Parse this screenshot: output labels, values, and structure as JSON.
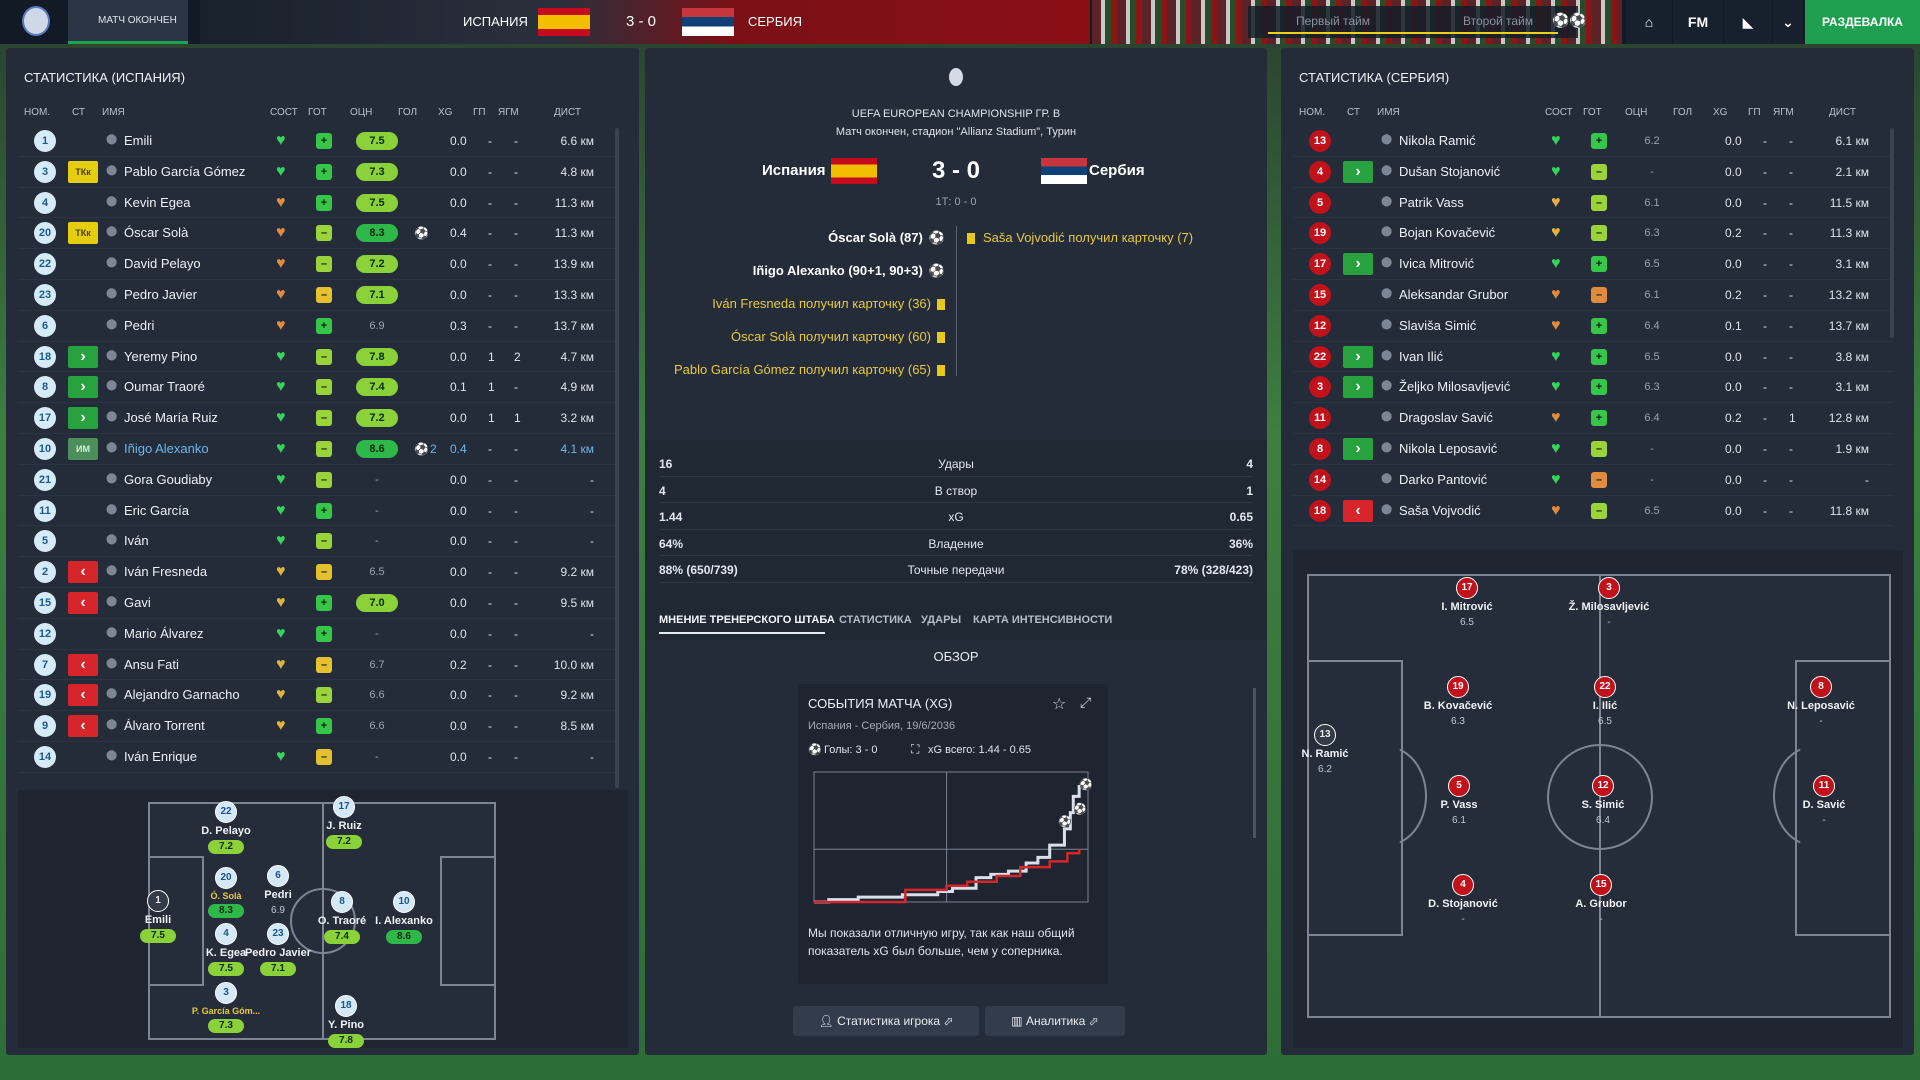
{
  "colors": {
    "accent_green": "#1fa050",
    "rating_green": "#2fb84a",
    "rating_lime": "#8ad13a",
    "rating_yellow": "#d6c23a",
    "heart_green": "#35d45a",
    "heart_orange": "#e08b3e",
    "red": "#c1121b",
    "blue": "#6ab7ee"
  },
  "topbar": {
    "status": "МАТЧ ОКОНЧЕН",
    "home_team": "ИСПАНИЯ",
    "score": "3 - 0",
    "away_team": "СЕРБИЯ",
    "first_half": "Первый тайм",
    "second_half": "Второй тайм",
    "fm_label": "FM",
    "continue_button": "РАЗДЕВАЛКА"
  },
  "left": {
    "title": "СТАТИСТИКА (ИСПАНИЯ)"
  },
  "right": {
    "title": "СТАТИСТИКА (СЕРБИЯ)"
  },
  "columns": {
    "num": "НОМ.",
    "st": "СТ",
    "name": "ИМЯ",
    "cond": "СОСТ",
    "fit": "ГОТ",
    "rating": "ОЦН",
    "goals": "ГОЛ",
    "xg": "XG",
    "gp": "ГП",
    "ygm": "ЯГМ",
    "dist": "ДИСТ"
  },
  "spain_players": [
    {
      "num": "1",
      "st": "",
      "name": "Emili",
      "cond": "green",
      "fit": "green",
      "rating": "7.5",
      "rc": "g",
      "goals": "",
      "xg": "0.0",
      "gp": "-",
      "ygm": "-",
      "dist": "6.6 км"
    },
    {
      "num": "3",
      "st": "cap",
      "st_label": "ТКк",
      "name": "Pablo García Gómez",
      "cond": "green",
      "fit": "green",
      "rating": "7.3",
      "rc": "g",
      "goals": "",
      "xg": "0.0",
      "gp": "-",
      "ygm": "-",
      "dist": "4.8 км"
    },
    {
      "num": "4",
      "st": "",
      "name": "Kevin Egea",
      "cond": "orange",
      "fit": "green",
      "rating": "7.5",
      "rc": "g",
      "goals": "",
      "xg": "0.0",
      "gp": "-",
      "ygm": "-",
      "dist": "11.3 км"
    },
    {
      "num": "20",
      "st": "cap",
      "st_label": "ТКк",
      "name": "Óscar Solà",
      "cond": "orange",
      "fit": "lime",
      "rating": "8.3",
      "rc": "g",
      "goals": "1",
      "xg": "0.4",
      "gp": "-",
      "ygm": "-",
      "dist": "11.3 км"
    },
    {
      "num": "22",
      "st": "",
      "name": "David Pelayo",
      "cond": "orange",
      "fit": "lime",
      "rating": "7.2",
      "rc": "g",
      "goals": "",
      "xg": "0.0",
      "gp": "-",
      "ygm": "-",
      "dist": "13.9 км"
    },
    {
      "num": "23",
      "st": "",
      "name": "Pedro Javier",
      "cond": "orange",
      "fit": "yellow",
      "rating": "7.1",
      "rc": "g",
      "goals": "",
      "xg": "0.0",
      "gp": "-",
      "ygm": "-",
      "dist": "13.3 км"
    },
    {
      "num": "6",
      "st": "",
      "name": "Pedri",
      "cond": "orange",
      "fit": "green",
      "rating": "6.9",
      "rc": "n",
      "goals": "",
      "xg": "0.3",
      "gp": "-",
      "ygm": "-",
      "dist": "13.7 км"
    },
    {
      "num": "18",
      "st": "in",
      "name": "Yeremy Pino",
      "cond": "green",
      "fit": "lime",
      "rating": "7.8",
      "rc": "g",
      "goals": "",
      "xg": "0.0",
      "gp": "1",
      "ygm": "2",
      "dist": "4.7 км"
    },
    {
      "num": "8",
      "st": "in",
      "name": "Oumar Traoré",
      "cond": "green",
      "fit": "lime",
      "rating": "7.4",
      "rc": "g",
      "goals": "",
      "xg": "0.1",
      "gp": "1",
      "ygm": "-",
      "dist": "4.9 км"
    },
    {
      "num": "17",
      "st": "in",
      "name": "José María Ruiz",
      "cond": "green",
      "fit": "lime",
      "rating": "7.2",
      "rc": "g",
      "goals": "",
      "xg": "0.0",
      "gp": "1",
      "ygm": "1",
      "dist": "3.2 км"
    },
    {
      "num": "10",
      "st": "ic",
      "st_label": "ИМ",
      "name": "Iñigo Alexanko",
      "cond": "green",
      "fit": "lime",
      "rating": "8.6",
      "rc": "g",
      "goals": "2",
      "xg": "0.4",
      "gp": "-",
      "ygm": "-",
      "dist": "4.1 км",
      "hl": true
    },
    {
      "num": "21",
      "st": "",
      "name": "Gora Goudiaby",
      "cond": "green",
      "fit": "lime",
      "rating": "-",
      "rc": "n",
      "goals": "",
      "xg": "0.0",
      "gp": "-",
      "ygm": "-",
      "dist": "-"
    },
    {
      "num": "11",
      "st": "",
      "name": "Eric García",
      "cond": "green",
      "fit": "green",
      "rating": "-",
      "rc": "n",
      "goals": "",
      "xg": "0.0",
      "gp": "-",
      "ygm": "-",
      "dist": "-"
    },
    {
      "num": "5",
      "st": "",
      "name": "Iván",
      "cond": "green",
      "fit": "lime",
      "rating": "-",
      "rc": "n",
      "goals": "",
      "xg": "0.0",
      "gp": "-",
      "ygm": "-",
      "dist": "-"
    },
    {
      "num": "2",
      "st": "out",
      "name": "Iván Fresneda",
      "cond": "yellow",
      "fit": "yellow",
      "rating": "6.5",
      "rc": "n",
      "goals": "",
      "xg": "0.0",
      "gp": "-",
      "ygm": "-",
      "dist": "9.2 км"
    },
    {
      "num": "15",
      "st": "out",
      "name": "Gavi",
      "cond": "yellow",
      "fit": "green",
      "rating": "7.0",
      "rc": "g",
      "goals": "",
      "xg": "0.0",
      "gp": "-",
      "ygm": "-",
      "dist": "9.5 км"
    },
    {
      "num": "12",
      "st": "",
      "name": "Mario Álvarez",
      "cond": "green",
      "fit": "green",
      "rating": "-",
      "rc": "n",
      "goals": "",
      "xg": "0.0",
      "gp": "-",
      "ygm": "-",
      "dist": "-"
    },
    {
      "num": "7",
      "st": "out",
      "name": "Ansu Fati",
      "cond": "yellow",
      "fit": "yellow",
      "rating": "6.7",
      "rc": "n",
      "goals": "",
      "xg": "0.2",
      "gp": "-",
      "ygm": "-",
      "dist": "10.0 км"
    },
    {
      "num": "19",
      "st": "out",
      "name": "Alejandro Garnacho",
      "cond": "yellow",
      "fit": "lime",
      "rating": "6.6",
      "rc": "n",
      "goals": "",
      "xg": "0.0",
      "gp": "-",
      "ygm": "-",
      "dist": "9.2 км"
    },
    {
      "num": "9",
      "st": "out",
      "name": "Álvaro Torrent",
      "cond": "yellow",
      "fit": "green",
      "rating": "6.6",
      "rc": "n",
      "goals": "",
      "xg": "0.0",
      "gp": "-",
      "ygm": "-",
      "dist": "8.5 км"
    },
    {
      "num": "14",
      "st": "",
      "name": "Iván Enrique",
      "cond": "green",
      "fit": "yellow",
      "rating": "-",
      "rc": "n",
      "goals": "",
      "xg": "0.0",
      "gp": "-",
      "ygm": "-",
      "dist": "-"
    }
  ],
  "serbia_players": [
    {
      "num": "13",
      "st": "",
      "name": "Nikola Ramić",
      "cond": "green",
      "fit": "green",
      "rating": "6.2",
      "xg": "0.0",
      "gp": "-",
      "ygm": "-",
      "dist": "6.1 км"
    },
    {
      "num": "4",
      "st": "in",
      "name": "Dušan Stojanović",
      "cond": "green",
      "fit": "lime",
      "rating": "-",
      "xg": "0.0",
      "gp": "-",
      "ygm": "-",
      "dist": "2.1 км"
    },
    {
      "num": "5",
      "st": "",
      "name": "Patrik Vass",
      "cond": "yellow",
      "fit": "lime",
      "rating": "6.1",
      "xg": "0.0",
      "gp": "-",
      "ygm": "-",
      "dist": "11.5 км"
    },
    {
      "num": "19",
      "st": "",
      "name": "Bojan Kovačević",
      "cond": "yellow",
      "fit": "lime",
      "rating": "6.3",
      "xg": "0.2",
      "gp": "-",
      "ygm": "-",
      "dist": "11.3 км"
    },
    {
      "num": "17",
      "st": "in",
      "name": "Ivica Mitrović",
      "cond": "green",
      "fit": "green",
      "rating": "6.5",
      "xg": "0.0",
      "gp": "-",
      "ygm": "-",
      "dist": "3.1 км"
    },
    {
      "num": "15",
      "st": "",
      "name": "Aleksandar Grubor",
      "cond": "orange",
      "fit": "orange",
      "rating": "6.1",
      "xg": "0.2",
      "gp": "-",
      "ygm": "-",
      "dist": "13.2 км"
    },
    {
      "num": "12",
      "st": "",
      "name": "Slaviša Simić",
      "cond": "orange",
      "fit": "green",
      "rating": "6.4",
      "xg": "0.1",
      "gp": "-",
      "ygm": "-",
      "dist": "13.7 км"
    },
    {
      "num": "22",
      "st": "in",
      "name": "Ivan Ilić",
      "cond": "green",
      "fit": "green",
      "rating": "6.5",
      "xg": "0.0",
      "gp": "-",
      "ygm": "-",
      "dist": "3.8 км"
    },
    {
      "num": "3",
      "st": "in",
      "name": "Željko Milosavljević",
      "cond": "green",
      "fit": "green",
      "rating": "6.3",
      "xg": "0.0",
      "gp": "-",
      "ygm": "-",
      "dist": "3.1 км"
    },
    {
      "num": "11",
      "st": "",
      "name": "Dragoslav Savić",
      "cond": "orange",
      "fit": "green",
      "rating": "6.4",
      "xg": "0.2",
      "gp": "-",
      "ygm": "1",
      "dist": "12.8 км"
    },
    {
      "num": "8",
      "st": "in",
      "name": "Nikola Leposavić",
      "cond": "green",
      "fit": "lime",
      "rating": "-",
      "xg": "0.0",
      "gp": "-",
      "ygm": "-",
      "dist": "1.9 км"
    },
    {
      "num": "14",
      "st": "",
      "name": "Darko Pantović",
      "cond": "green",
      "fit": "orange",
      "rating": "-",
      "xg": "0.0",
      "gp": "-",
      "ygm": "-",
      "dist": "-"
    },
    {
      "num": "18",
      "st": "out",
      "name": "Saša Vojvodić",
      "cond": "orange",
      "fit": "lime",
      "rating": "6.5",
      "xg": "0.0",
      "gp": "-",
      "ygm": "-",
      "dist": "11.8 км"
    }
  ],
  "spain_formation": [
    {
      "num": "1",
      "name": "Emili",
      "rating": "7.5",
      "gk": true
    },
    {
      "num": "22",
      "name": "D. Pelayo",
      "rating": "7.2"
    },
    {
      "num": "20",
      "name": "Ó. Solà",
      "rating": "8.3",
      "gold": true
    },
    {
      "num": "4",
      "name": "K. Egea",
      "rating": "7.5"
    },
    {
      "num": "3",
      "name": "P. García Góm...",
      "rating": "7.3",
      "gold": true
    },
    {
      "num": "6",
      "name": "Pedri",
      "rating": "6.9",
      "plain": true
    },
    {
      "num": "23",
      "name": "Pedro Javier",
      "rating": "7.1"
    },
    {
      "num": "17",
      "name": "J. Ruiz",
      "rating": "7.2"
    },
    {
      "num": "8",
      "name": "O. Traoré",
      "rating": "7.4"
    },
    {
      "num": "18",
      "name": "Y. Pino",
      "rating": "7.8"
    },
    {
      "num": "10",
      "name": "I. Alexanko",
      "rating": "8.6"
    }
  ],
  "serbia_formation": [
    {
      "num": "13",
      "name": "N. Ramić",
      "rating": "6.2",
      "gk": true
    },
    {
      "num": "17",
      "name": "I. Mitrović",
      "rating": "6.5"
    },
    {
      "num": "3",
      "name": "Ž. Milosavljević",
      "rating": "-"
    },
    {
      "num": "19",
      "name": "B. Kovačević",
      "rating": "6.3"
    },
    {
      "num": "22",
      "name": "I. Ilić",
      "rating": "6.5"
    },
    {
      "num": "8",
      "name": "N. Leposavić",
      "rating": "-"
    },
    {
      "num": "5",
      "name": "P. Vass",
      "rating": "6.1"
    },
    {
      "num": "12",
      "name": "S. Simić",
      "rating": "6.4"
    },
    {
      "num": "11",
      "name": "D. Savić",
      "rating": "-"
    },
    {
      "num": "4",
      "name": "D. Stojanović",
      "rating": "-"
    },
    {
      "num": "15",
      "name": "A. Grubor",
      "rating": "-"
    }
  ],
  "match": {
    "competition": "UEFA EUROPEAN CHAMPIONSHIP ГР. В",
    "status_line": "Матч окончен, стадион \"Allianz Stadium\", Турин",
    "home": "Испания",
    "away": "Сербия",
    "score": "3 - 0",
    "ht": "1Т: 0 - 0",
    "events_home": [
      {
        "text": "Óscar Solà (87)",
        "icon": "ball"
      },
      {
        "text": "Iñigo Alexanko (90+1, 90+3)",
        "icon": "ball"
      },
      {
        "text": "Iván Fresneda получил карточку (36)",
        "icon": "card"
      },
      {
        "text": "Óscar Solà получил карточку (60)",
        "icon": "card"
      },
      {
        "text": "Pablo García Gómez получил карточку (65)",
        "icon": "card"
      }
    ],
    "events_away": [
      {
        "text": "Saša Vojvodić получил карточку (7)",
        "icon": "card"
      }
    ]
  },
  "stats": [
    {
      "home": "16",
      "label": "Удары",
      "away": "4"
    },
    {
      "home": "4",
      "label": "В створ",
      "away": "1"
    },
    {
      "home": "1.44",
      "label": "xG",
      "away": "0.65"
    },
    {
      "home": "64%",
      "label": "Владение",
      "away": "36%"
    },
    {
      "home": "88% (650/739)",
      "label": "Точные передачи",
      "away": "78% (328/423)"
    }
  ],
  "tabs": [
    "МНЕНИЕ ТРЕНЕРСКОГО ШТАБА",
    "СТАТИСТИКА",
    "УДАРЫ",
    "КАРТА ИНТЕНСИВНОСТИ"
  ],
  "overview": {
    "title": "ОБЗОР",
    "card_title": "СОБЫТИЯ МАТЧА (XG)",
    "card_sub": "Испания - Сербия, 19/6/2036",
    "goals_label": "Голы: 3 - 0",
    "xg_label": "xG всего: 1.44 - 0.65",
    "comment": "Мы показали отличную игру, так как наш общий показатель xG был больше, чем у соперника.",
    "btn_player": "Статистика игрока",
    "btn_analytics": "Аналитика"
  },
  "chart_data": {
    "type": "line",
    "series": [
      {
        "values": [
          [
            0,
            0
          ],
          [
            5,
            0.03
          ],
          [
            15,
            0.06
          ],
          [
            30,
            0.09
          ],
          [
            42,
            0.13
          ],
          [
            47,
            0.17
          ],
          [
            55,
            0.3
          ],
          [
            60,
            0.34
          ],
          [
            66,
            0.38
          ],
          [
            72,
            0.48
          ],
          [
            76,
            0.55
          ],
          [
            80,
            0.7
          ],
          [
            85,
            0.9
          ],
          [
            87,
            1.1
          ],
          [
            88,
            1.3
          ],
          [
            90,
            1.44
          ]
        ]
      },
      {
        "values": [
          [
            0,
            0
          ],
          [
            30,
            0
          ],
          [
            31,
            0.15
          ],
          [
            45,
            0.2
          ],
          [
            52,
            0.25
          ],
          [
            62,
            0.32
          ],
          [
            70,
            0.43
          ],
          [
            80,
            0.5
          ],
          [
            86,
            0.6
          ],
          [
            90,
            0.65
          ]
        ]
      }
    ],
    "goals_home_minutes": [
      87,
      90,
      92
    ]
  }
}
